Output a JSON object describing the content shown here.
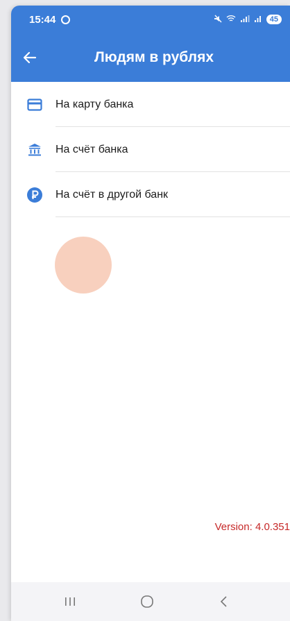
{
  "status_bar": {
    "time": "15:44",
    "battery": "45"
  },
  "header": {
    "title": "Людям в рублях"
  },
  "menu": {
    "items": [
      {
        "label": "На карту банка",
        "icon": "card-icon"
      },
      {
        "label": "На счёт банка",
        "icon": "bank-icon"
      },
      {
        "label": "На счёт в другой банк",
        "icon": "ruble-icon"
      }
    ]
  },
  "footer": {
    "version": "Version: 4.0.351"
  },
  "colors": {
    "accent": "#3b7dd8",
    "version_text": "#c62828"
  }
}
